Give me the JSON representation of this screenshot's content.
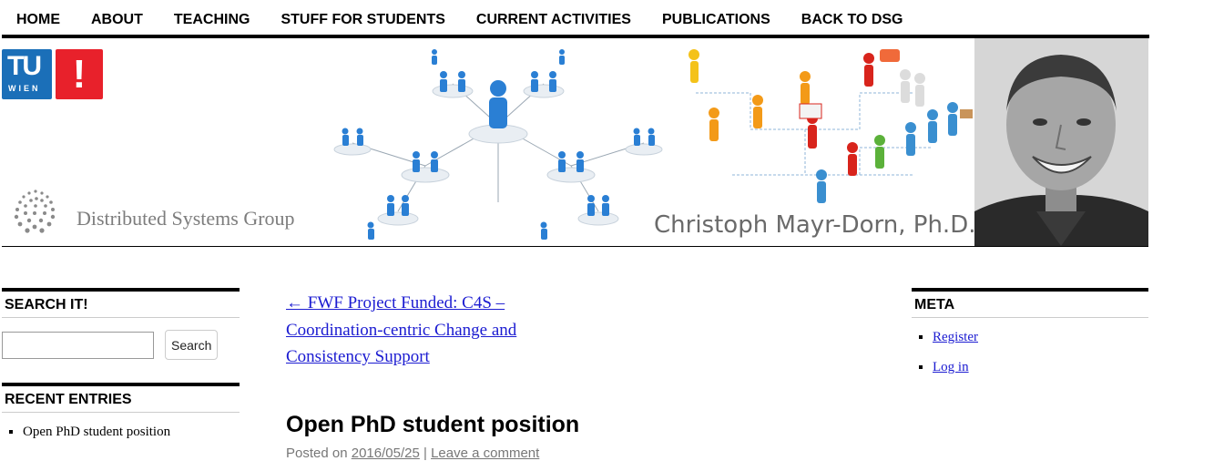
{
  "nav": {
    "items": [
      "HOME",
      "ABOUT",
      "TEACHING",
      "STUFF FOR STUDENTS",
      "CURRENT ACTIVITIES",
      "PUBLICATIONS",
      "BACK TO DSG"
    ]
  },
  "banner": {
    "tu_logo_text": "TU",
    "tu_logo_subtext": "WIEN",
    "exclamation": "!",
    "group_name": "Distributed Systems Group",
    "person_name": "Christoph Mayr-Dorn, Ph.D."
  },
  "sidebar_left": {
    "search_title": "SEARCH IT!",
    "search_placeholder": "",
    "search_button": "Search",
    "recent_title": "RECENT ENTRIES",
    "recent_items": [
      "Open PhD student position"
    ]
  },
  "main": {
    "prev_link": "← FWF Project Funded: C4S – Coordination-centric Change and Consistency Support",
    "post_title": "Open PhD student position",
    "posted_on_label": "Posted on",
    "posted_date": "2016/05/25",
    "separator": "|",
    "comment_link": "Leave a comment"
  },
  "meta": {
    "title": "META",
    "items": [
      "Register",
      "Log in"
    ]
  },
  "colors": {
    "link": "#1b1bd1",
    "tu_blue": "#1b6fb8",
    "tu_red": "#e8212b"
  }
}
